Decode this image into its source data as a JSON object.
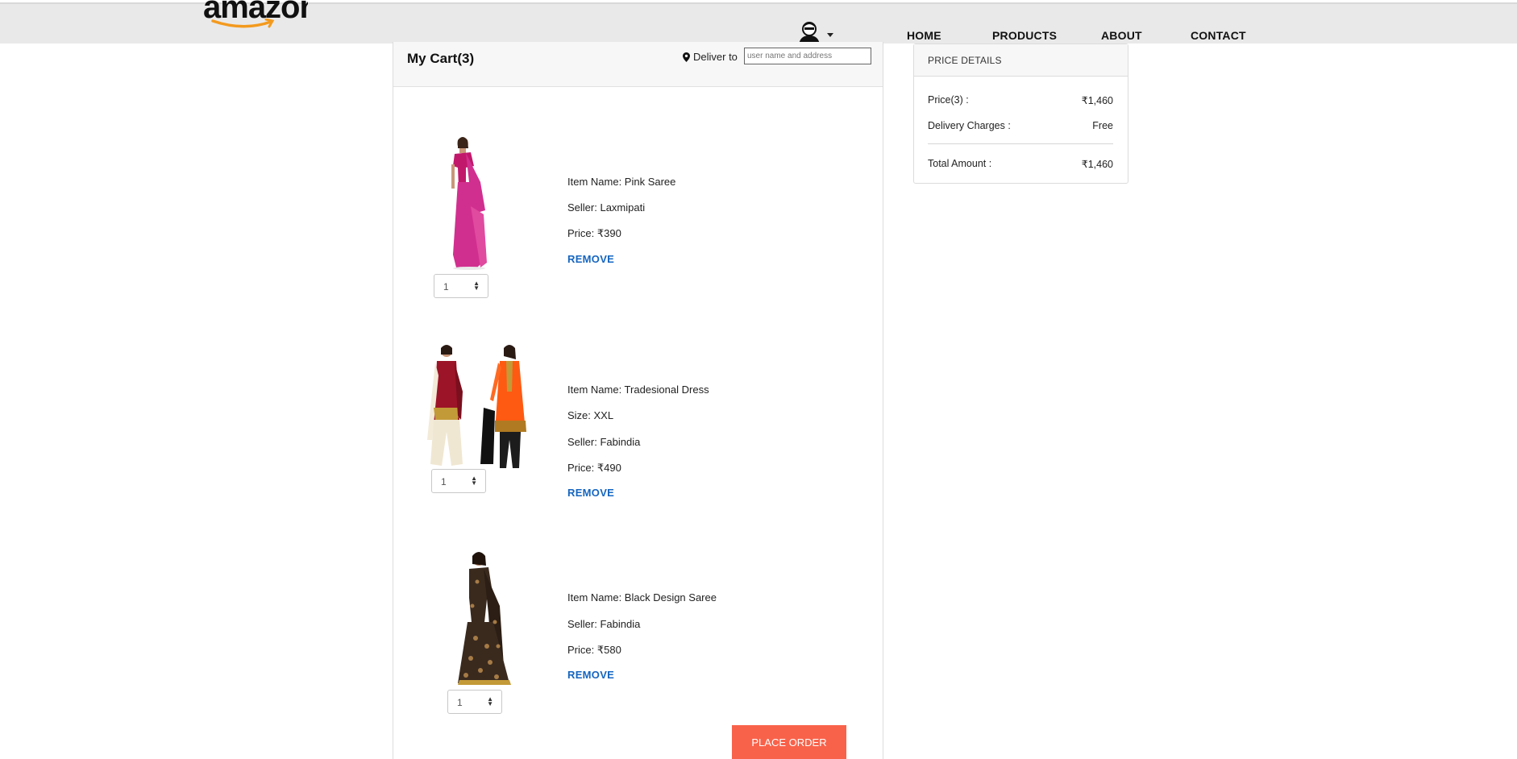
{
  "nav": {
    "logo_text": "amazon",
    "links": [
      "HOME",
      "PRODUCTS",
      "ABOUT",
      "CONTACT"
    ]
  },
  "cart": {
    "title": "My Cart(3)",
    "deliver_label": "Deliver to",
    "deliver_placeholder": "user name and address",
    "items": [
      {
        "lines": [
          "Item Name: Pink Saree",
          "Seller: Laxmipati",
          "Price: ₹390"
        ],
        "remove_label": "REMOVE",
        "qty": "1",
        "image": "pink-saree"
      },
      {
        "lines": [
          "Item Name: Tradesional Dress",
          "Size: XXL",
          "Seller: Fabindia",
          "Price: ₹490"
        ],
        "remove_label": "REMOVE",
        "qty": "1",
        "image": "traditional-dress"
      },
      {
        "lines": [
          "Item Name: Black Design Saree",
          "Seller: Fabindia",
          "Price: ₹580"
        ],
        "remove_label": "REMOVE",
        "qty": "1",
        "image": "black-design-saree"
      }
    ],
    "place_order_label": "PLACE ORDER"
  },
  "price_details": {
    "heading": "PRICE DETAILS",
    "rows": [
      {
        "label": "Price(3) :",
        "value": "₹1,460"
      },
      {
        "label": "Delivery Charges :",
        "value": "Free"
      }
    ],
    "total": {
      "label": "Total Amount :",
      "value": "₹1,460"
    }
  },
  "colors": {
    "accent_link": "#1565c0",
    "place_order_bg": "#f9624a",
    "nav_bg": "#e9e9e9",
    "pink_saree": "#d12f8f",
    "orange_dress": "#ff5a12",
    "maroon_dress": "#9c1427",
    "black_saree": "#3a2a1e"
  }
}
